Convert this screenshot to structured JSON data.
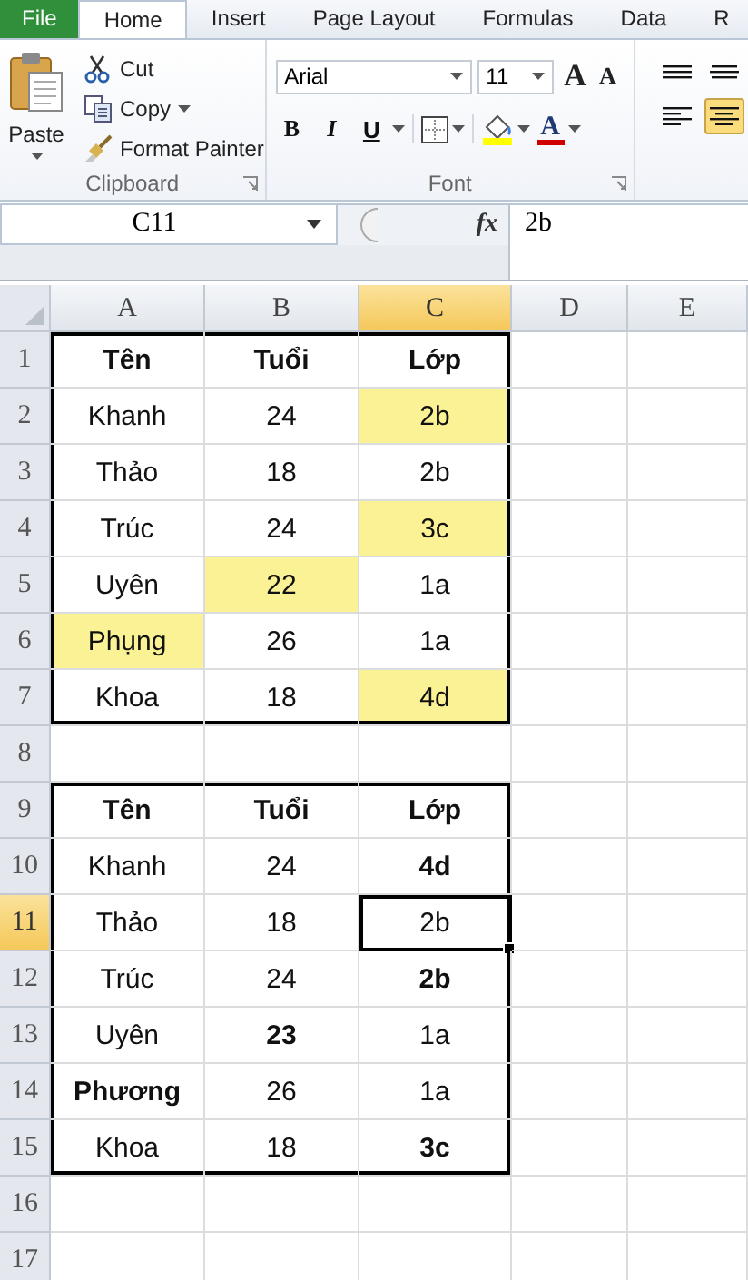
{
  "ribbon_tabs": [
    {
      "label": "File",
      "kind": "file",
      "selected": false
    },
    {
      "label": "Home",
      "kind": "tab",
      "selected": true
    },
    {
      "label": "Insert",
      "kind": "tab",
      "selected": false
    },
    {
      "label": "Page Layout",
      "kind": "tab",
      "selected": false
    },
    {
      "label": "Formulas",
      "kind": "tab",
      "selected": false
    },
    {
      "label": "Data",
      "kind": "tab",
      "selected": false
    },
    {
      "label": "R",
      "kind": "tab",
      "selected": false
    }
  ],
  "clipboard": {
    "paste": "Paste",
    "cut": "Cut",
    "copy": "Copy",
    "format_painter": "Format Painter",
    "group_label": "Clipboard"
  },
  "font": {
    "font_name": "Arial",
    "font_size": "11",
    "grow": "A",
    "shrink": "A",
    "style_buttons": [
      {
        "label": "B",
        "kind": "bold"
      },
      {
        "label": "I",
        "kind": "italic"
      },
      {
        "label": "U",
        "kind": "underline"
      }
    ],
    "font_color": "A",
    "group_label": "Font"
  },
  "alignment": [
    {
      "kind": "top",
      "selected": false
    },
    {
      "kind": "middle",
      "selected": false
    },
    {
      "kind": "left",
      "selected": false
    },
    {
      "kind": "center",
      "selected": true
    }
  ],
  "formula_bar": {
    "name_box": "C11",
    "fx": "fx",
    "value": "2b"
  },
  "columns": [
    {
      "label": "A",
      "selected": false
    },
    {
      "label": "B",
      "selected": false
    },
    {
      "label": "C",
      "selected": true
    },
    {
      "label": "D",
      "selected": false
    },
    {
      "label": "E",
      "selected": false
    }
  ],
  "rows": [
    {
      "number": "1",
      "selected": false,
      "cells": [
        {
          "text": "Tên",
          "bold": true,
          "fill": false,
          "selected": false,
          "outline": {
            "top": true,
            "left": true
          }
        },
        {
          "text": "Tuổi",
          "bold": true,
          "fill": false,
          "selected": false,
          "outline": {
            "top": true
          }
        },
        {
          "text": "Lớp",
          "bold": true,
          "fill": false,
          "selected": false,
          "outline": {
            "top": true,
            "right": true
          }
        }
      ]
    },
    {
      "number": "2",
      "selected": false,
      "cells": [
        {
          "text": "Khanh",
          "bold": false,
          "fill": false,
          "selected": false,
          "outline": {
            "left": true
          }
        },
        {
          "text": "24",
          "bold": false,
          "fill": false,
          "selected": false
        },
        {
          "text": "2b",
          "bold": false,
          "fill": true,
          "selected": false,
          "outline": {
            "right": true
          }
        }
      ]
    },
    {
      "number": "3",
      "selected": false,
      "cells": [
        {
          "text": "Thảo",
          "bold": false,
          "fill": false,
          "selected": false,
          "outline": {
            "left": true
          }
        },
        {
          "text": "18",
          "bold": false,
          "fill": false,
          "selected": false
        },
        {
          "text": "2b",
          "bold": false,
          "fill": false,
          "selected": false,
          "outline": {
            "right": true
          }
        }
      ]
    },
    {
      "number": "4",
      "selected": false,
      "cells": [
        {
          "text": "Trúc",
          "bold": false,
          "fill": false,
          "selected": false,
          "outline": {
            "left": true
          }
        },
        {
          "text": "24",
          "bold": false,
          "fill": false,
          "selected": false
        },
        {
          "text": "3c",
          "bold": false,
          "fill": true,
          "selected": false,
          "outline": {
            "right": true
          }
        }
      ]
    },
    {
      "number": "5",
      "selected": false,
      "cells": [
        {
          "text": "Uyên",
          "bold": false,
          "fill": false,
          "selected": false,
          "outline": {
            "left": true
          }
        },
        {
          "text": "22",
          "bold": false,
          "fill": true,
          "selected": false
        },
        {
          "text": "1a",
          "bold": false,
          "fill": false,
          "selected": false,
          "outline": {
            "right": true
          }
        }
      ]
    },
    {
      "number": "6",
      "selected": false,
      "cells": [
        {
          "text": "Phụng",
          "bold": false,
          "fill": true,
          "selected": false,
          "outline": {
            "left": true
          }
        },
        {
          "text": "26",
          "bold": false,
          "fill": false,
          "selected": false
        },
        {
          "text": "1a",
          "bold": false,
          "fill": false,
          "selected": false,
          "outline": {
            "right": true
          }
        }
      ]
    },
    {
      "number": "7",
      "selected": false,
      "cells": [
        {
          "text": "Khoa",
          "bold": false,
          "fill": false,
          "selected": false,
          "outline": {
            "bottom": true,
            "left": true
          }
        },
        {
          "text": "18",
          "bold": false,
          "fill": false,
          "selected": false,
          "outline": {
            "bottom": true
          }
        },
        {
          "text": "4d",
          "bold": false,
          "fill": true,
          "selected": false,
          "outline": {
            "bottom": true,
            "right": true
          }
        }
      ]
    },
    {
      "number": "8",
      "selected": false
    },
    {
      "number": "9",
      "selected": false,
      "cells": [
        {
          "text": "Tên",
          "bold": true,
          "fill": false,
          "selected": false,
          "outline": {
            "top": true,
            "left": true
          }
        },
        {
          "text": "Tuổi",
          "bold": true,
          "fill": false,
          "selected": false,
          "outline": {
            "top": true
          }
        },
        {
          "text": "Lớp",
          "bold": true,
          "fill": false,
          "selected": false,
          "outline": {
            "top": true,
            "right": true
          }
        }
      ]
    },
    {
      "number": "10",
      "selected": false,
      "cells": [
        {
          "text": "Khanh",
          "bold": false,
          "fill": false,
          "selected": false,
          "outline": {
            "left": true
          }
        },
        {
          "text": "24",
          "bold": false,
          "fill": false,
          "selected": false
        },
        {
          "text": "4d",
          "bold": true,
          "fill": false,
          "selected": false,
          "outline": {
            "right": true
          }
        }
      ]
    },
    {
      "number": "11",
      "selected": true,
      "cells": [
        {
          "text": "Thảo",
          "bold": false,
          "fill": false,
          "selected": false,
          "outline": {
            "left": true
          }
        },
        {
          "text": "18",
          "bold": false,
          "fill": false,
          "selected": false
        },
        {
          "text": "2b",
          "bold": false,
          "fill": false,
          "selected": true,
          "outline": {
            "right": true
          }
        }
      ]
    },
    {
      "number": "12",
      "selected": false,
      "cells": [
        {
          "text": "Trúc",
          "bold": false,
          "fill": false,
          "selected": false,
          "outline": {
            "left": true
          }
        },
        {
          "text": "24",
          "bold": false,
          "fill": false,
          "selected": false
        },
        {
          "text": "2b",
          "bold": true,
          "fill": false,
          "selected": false,
          "outline": {
            "right": true
          }
        }
      ]
    },
    {
      "number": "13",
      "selected": false,
      "cells": [
        {
          "text": "Uyên",
          "bold": false,
          "fill": false,
          "selected": false,
          "outline": {
            "left": true
          }
        },
        {
          "text": "23",
          "bold": true,
          "fill": false,
          "selected": false
        },
        {
          "text": "1a",
          "bold": false,
          "fill": false,
          "selected": false,
          "outline": {
            "right": true
          }
        }
      ]
    },
    {
      "number": "14",
      "selected": false,
      "cells": [
        {
          "text": "Phương",
          "bold": true,
          "fill": false,
          "selected": false,
          "outline": {
            "left": true
          }
        },
        {
          "text": "26",
          "bold": false,
          "fill": false,
          "selected": false
        },
        {
          "text": "1a",
          "bold": false,
          "fill": false,
          "selected": false,
          "outline": {
            "right": true
          }
        }
      ]
    },
    {
      "number": "15",
      "selected": false,
      "cells": [
        {
          "text": "Khoa",
          "bold": false,
          "fill": false,
          "selected": false,
          "outline": {
            "bottom": true,
            "left": true
          }
        },
        {
          "text": "18",
          "bold": false,
          "fill": false,
          "selected": false,
          "outline": {
            "bottom": true
          }
        },
        {
          "text": "3c",
          "bold": true,
          "fill": false,
          "selected": false,
          "outline": {
            "bottom": true,
            "right": true
          }
        }
      ]
    },
    {
      "number": "16",
      "selected": false
    },
    {
      "number": "17",
      "selected": false
    }
  ]
}
